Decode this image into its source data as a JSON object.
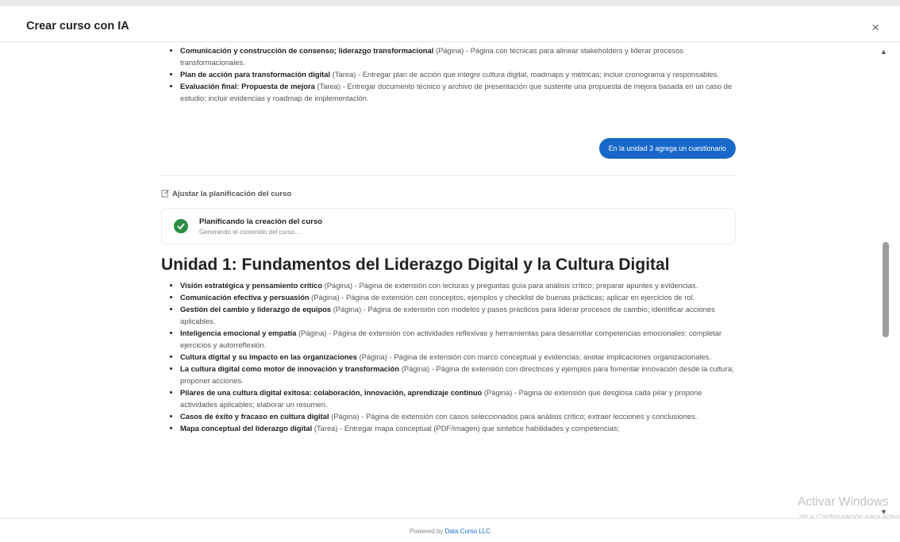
{
  "modal": {
    "title": "Crear curso con IA",
    "close_symbol": "×"
  },
  "top_items": [
    {
      "title": "Comunicación y construcción de consenso; liderazgo transformacional",
      "type": "(Página)",
      "desc": "- Página con técnicas para alinear stakeholders y liderar procesos transformacionales."
    },
    {
      "title": "Plan de acción para transformación digital",
      "type": "(Tarea)",
      "desc": "- Entregar plan de acción que integre cultura digital, roadmaps y métricas; incluir cronograma y responsables."
    },
    {
      "title": "Evaluación final: Propuesta de mejora",
      "type": "(Tarea)",
      "desc": "- Entregar documento técnico y archivo de presentación que sustente una propuesta de mejora basada en un caso de estudio; incluir evidencias y roadmap de implementación."
    }
  ],
  "user_message": "En la unidad 3 agrega un cuestionario",
  "adjust_label": "Ajustar la planificación del curso",
  "status": {
    "title": "Planificando la creación del curso",
    "subtitle": "Generando el contenido del curso..."
  },
  "unit1": {
    "heading": "Unidad 1: Fundamentos del Liderazgo Digital y la Cultura Digital",
    "items": [
      {
        "title": "Visión estratégica y pensamiento crítico",
        "type": "(Página)",
        "desc": "- Página de extensión con lecturas y preguntas guía para análisis crítico; preparar apuntes y evidencias."
      },
      {
        "title": "Comunicación efectiva y persuasión",
        "type": "(Página)",
        "desc": "- Página de extensión con conceptos, ejemplos y checklist de buenas prácticas; aplicar en ejercicios de rol."
      },
      {
        "title": "Gestión del cambio y liderazgo de equipos",
        "type": "(Página)",
        "desc": "- Página de extensión con modelos y pasos prácticos para liderar procesos de cambio; identificar acciones aplicables."
      },
      {
        "title": "Inteligencia emocional y empatía",
        "type": "(Página)",
        "desc": "- Página de extensión con actividades reflexivas y herramientas para desarrollar competencias emocionales; completar ejercicios y autorreflexión."
      },
      {
        "title": "Cultura digital y su impacto en las organizaciones",
        "type": "(Página)",
        "desc": "- Página de extensión con marco conceptual y evidencias; anotar implicaciones organizacionales."
      },
      {
        "title": "La cultura digital como motor de innovación y transformación",
        "type": "(Página)",
        "desc": "- Página de extensión con directrices y ejemplos para fomentar innovación desde la cultura; proponer acciones."
      },
      {
        "title": "Pilares de una cultura digital exitosa: colaboración, innovación, aprendizaje continuo",
        "type": "(Página)",
        "desc": "- Página de extensión que desglosa cada pilar y propone actividades aplicables; elaborar un resumen."
      },
      {
        "title": "Casos de éxito y fracaso en cultura digital",
        "type": "(Página)",
        "desc": "- Página de extensión con casos seleccionados para análisis crítico; extraer lecciones y conclusiones."
      },
      {
        "title": "Mapa conceptual del liderazgo digital",
        "type": "(Tarea)",
        "desc": "- Entregar mapa conceptual (PDF/imagen) que sintetice habilidades y competencias;"
      }
    ]
  },
  "footer": {
    "prefix": "Powered by",
    "link": "Data Curso LLC"
  },
  "watermark": {
    "title": "Activar Windows",
    "sub": "Ve a Configuración para activar Windows."
  },
  "colors": {
    "accent": "#1768c9",
    "success": "#2f8f46"
  }
}
